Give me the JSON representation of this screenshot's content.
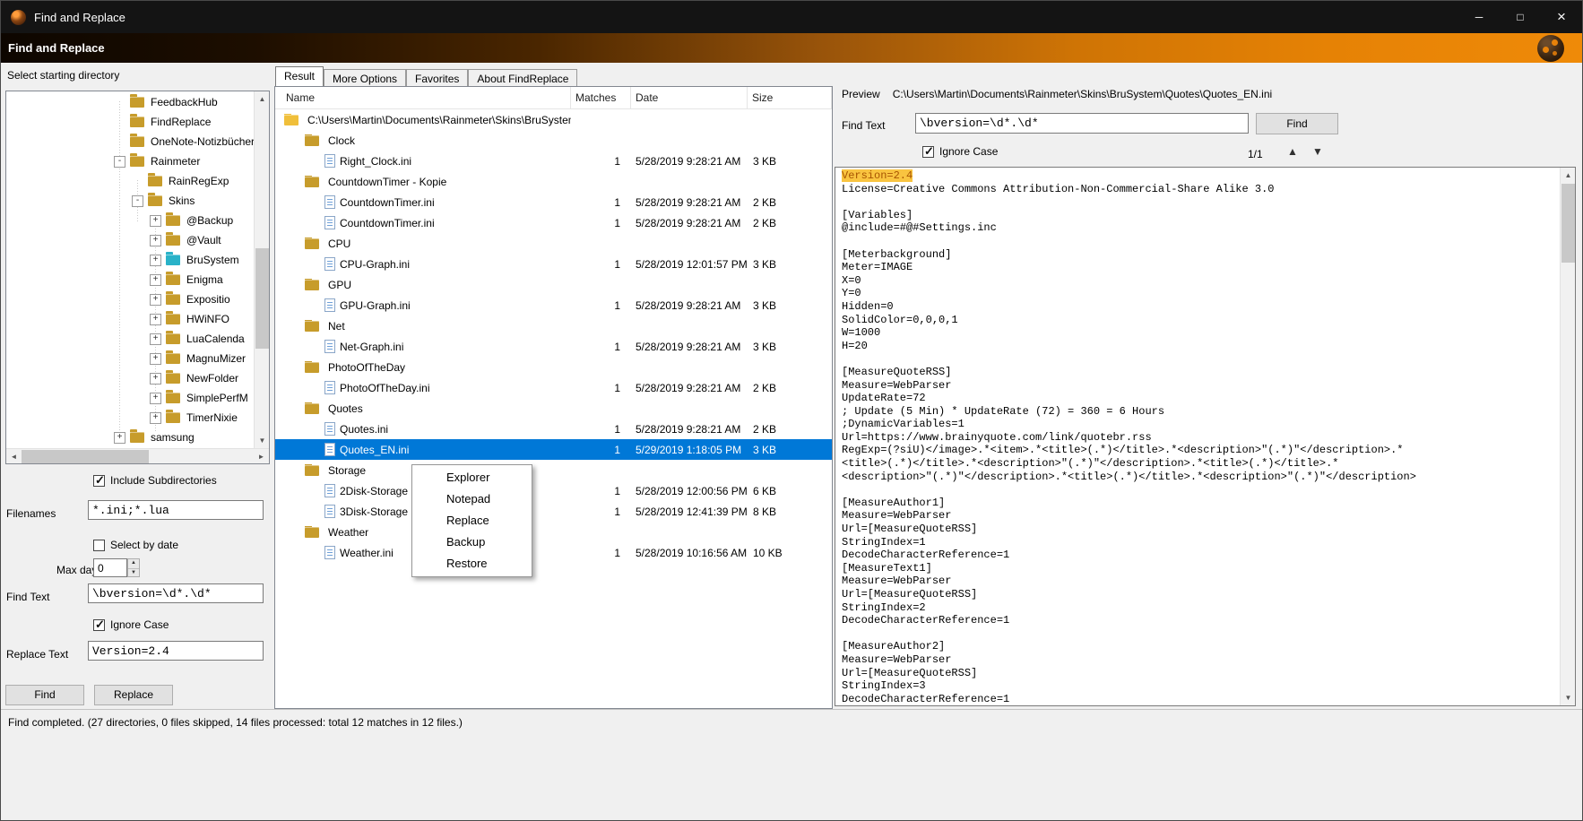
{
  "colors": {
    "accent_selection": "#0078D7",
    "banner_orange": "#EA8406",
    "match_highlight_bg": "#F9C440",
    "match_highlight_text": "#A85400",
    "folder_yellow": "#C79C2B",
    "folder_teal": "#29B2C8"
  },
  "titlebar": {
    "title": "Find and Replace",
    "minimize_glyph": "─",
    "maximize_glyph": "□",
    "close_glyph": "×"
  },
  "banner": {
    "title": "Find and Replace"
  },
  "left_panel": {
    "heading": "Select starting directory",
    "tree": [
      {
        "label": "FeedbackHub",
        "depth": 1,
        "expander": "",
        "selected": false
      },
      {
        "label": "FindReplace",
        "depth": 1,
        "expander": "",
        "selected": false
      },
      {
        "label": "OneNote-Notizbücher",
        "depth": 1,
        "expander": "",
        "selected": false
      },
      {
        "label": "Rainmeter",
        "depth": 1,
        "expander": "-",
        "selected": false
      },
      {
        "label": "RainRegExp",
        "depth": 2,
        "expander": "",
        "selected": false
      },
      {
        "label": "Skins",
        "depth": 2,
        "expander": "-",
        "selected": false
      },
      {
        "label": "@Backup",
        "depth": 3,
        "expander": "+",
        "selected": false
      },
      {
        "label": "@Vault",
        "depth": 3,
        "expander": "+",
        "selected": false
      },
      {
        "label": "BruSystem",
        "depth": 3,
        "expander": "+",
        "selected": true
      },
      {
        "label": "Enigma",
        "depth": 3,
        "expander": "+",
        "selected": false
      },
      {
        "label": "Expositio",
        "depth": 3,
        "expander": "+",
        "selected": false
      },
      {
        "label": "HWiNFO",
        "depth": 3,
        "expander": "+",
        "selected": false
      },
      {
        "label": "LuaCalenda",
        "depth": 3,
        "expander": "+",
        "selected": false
      },
      {
        "label": "MagnuMizer",
        "depth": 3,
        "expander": "+",
        "selected": false
      },
      {
        "label": "NewFolder",
        "depth": 3,
        "expander": "+",
        "selected": false
      },
      {
        "label": "SimplePerfM",
        "depth": 3,
        "expander": "+",
        "selected": false
      },
      {
        "label": "TimerNixie",
        "depth": 3,
        "expander": "+",
        "selected": false
      },
      {
        "label": "samsung",
        "depth": 1,
        "expander": "+",
        "selected": false
      }
    ],
    "include_subdirectories": {
      "label": "Include Subdirectories",
      "checked": true
    },
    "filenames": {
      "label": "Filenames",
      "value": "*.ini;*.lua"
    },
    "select_by_date": {
      "label": "Select by date",
      "checked": false
    },
    "max_days": {
      "label": "Max days",
      "value": "0"
    },
    "find_text": {
      "label": "Find Text",
      "value": "\\bversion=\\d*.\\d*"
    },
    "ignore_case": {
      "label": "Ignore Case",
      "checked": true
    },
    "replace_text": {
      "label": "Replace Text",
      "value": "Version=2.4"
    },
    "find_button": "Find",
    "replace_button": "Replace"
  },
  "tabs": {
    "items": [
      "Result",
      "More Options",
      "Favorites",
      "About FindReplace"
    ],
    "active_index": 0
  },
  "results": {
    "columns": [
      "Name",
      "Matches",
      "Date",
      "Size"
    ],
    "rows": [
      {
        "type": "root",
        "name": "C:\\Users\\Martin\\Documents\\Rainmeter\\Skins\\BruSystem",
        "matches": "",
        "date": "",
        "size": ""
      },
      {
        "type": "folder",
        "name": "Clock",
        "matches": "",
        "date": "",
        "size": ""
      },
      {
        "type": "file",
        "name": "Right_Clock.ini",
        "matches": "1",
        "date": "5/28/2019 9:28:21 AM",
        "size": "3 KB"
      },
      {
        "type": "folder",
        "name": "CountdownTimer - Kopie",
        "matches": "",
        "date": "",
        "size": ""
      },
      {
        "type": "file",
        "name": "CountdownTimer.ini",
        "matches": "1",
        "date": "5/28/2019 9:28:21 AM",
        "size": "2 KB"
      },
      {
        "type": "file",
        "name": "CountdownTimer.ini",
        "matches": "1",
        "date": "5/28/2019 9:28:21 AM",
        "size": "2 KB"
      },
      {
        "type": "folder",
        "name": "CPU",
        "matches": "",
        "date": "",
        "size": ""
      },
      {
        "type": "file",
        "name": "CPU-Graph.ini",
        "matches": "1",
        "date": "5/28/2019 12:01:57 PM",
        "size": "3 KB"
      },
      {
        "type": "folder",
        "name": "GPU",
        "matches": "",
        "date": "",
        "size": ""
      },
      {
        "type": "file",
        "name": "GPU-Graph.ini",
        "matches": "1",
        "date": "5/28/2019 9:28:21 AM",
        "size": "3 KB"
      },
      {
        "type": "folder",
        "name": "Net",
        "matches": "",
        "date": "",
        "size": ""
      },
      {
        "type": "file",
        "name": "Net-Graph.ini",
        "matches": "1",
        "date": "5/28/2019 9:28:21 AM",
        "size": "3 KB"
      },
      {
        "type": "folder",
        "name": "PhotoOfTheDay",
        "matches": "",
        "date": "",
        "size": ""
      },
      {
        "type": "file",
        "name": "PhotoOfTheDay.ini",
        "matches": "1",
        "date": "5/28/2019 9:28:21 AM",
        "size": "2 KB"
      },
      {
        "type": "folder",
        "name": "Quotes",
        "matches": "",
        "date": "",
        "size": ""
      },
      {
        "type": "file",
        "name": "Quotes.ini",
        "matches": "1",
        "date": "5/28/2019 9:28:21 AM",
        "size": "2 KB"
      },
      {
        "type": "file",
        "name": "Quotes_EN.ini",
        "matches": "1",
        "date": "5/29/2019 1:18:05 PM",
        "size": "3 KB",
        "selected": true
      },
      {
        "type": "folder",
        "name": "Storage",
        "matches": "",
        "date": "",
        "size": ""
      },
      {
        "type": "file",
        "name": "2Disk-Storage",
        "matches": "1",
        "date": "5/28/2019 12:00:56 PM",
        "size": "6 KB"
      },
      {
        "type": "file",
        "name": "3Disk-Storage",
        "matches": "1",
        "date": "5/28/2019 12:41:39 PM",
        "size": "8 KB"
      },
      {
        "type": "folder",
        "name": "Weather",
        "matches": "",
        "date": "",
        "size": ""
      },
      {
        "type": "file",
        "name": "Weather.ini",
        "matches": "1",
        "date": "5/28/2019 10:16:56 AM",
        "size": "10 KB"
      }
    ]
  },
  "context_menu": {
    "items": [
      "Explorer",
      "Notepad",
      "Replace",
      "Backup",
      "Restore"
    ]
  },
  "preview_panel": {
    "label": "Preview",
    "path": "C:\\Users\\Martin\\Documents\\Rainmeter\\Skins\\BruSystem\\Quotes\\Quotes_EN.ini",
    "find_label": "Find Text",
    "find_value": "\\bversion=\\d*.\\d*",
    "find_button": "Find",
    "ignore_case": {
      "label": "Ignore Case",
      "checked": true
    },
    "match_counter": "1/1",
    "prev_glyph": "▲",
    "next_glyph": "▼",
    "highlight_line_index": 0,
    "lines": [
      "Version=2.4",
      "License=Creative Commons Attribution-Non-Commercial-Share Alike 3.0",
      "",
      "[Variables]",
      "@include=#@#Settings.inc",
      "",
      "[Meterbackground]",
      "Meter=IMAGE",
      "X=0",
      "Y=0",
      "Hidden=0",
      "SolidColor=0,0,0,1",
      "W=1000",
      "H=20",
      "",
      "[MeasureQuoteRSS]",
      "Measure=WebParser",
      "UpdateRate=72",
      "; Update (5 Min) * UpdateRate (72) = 360 = 6 Hours",
      ";DynamicVariables=1",
      "Url=https://www.brainyquote.com/link/quotebr.rss",
      "RegExp=(?siU)</image>.*<item>.*<title>(.*)</title>.*<description>\"(.*)\"</description>.*",
      "<title>(.*)</title>.*<description>\"(.*)\"</description>.*<title>(.*)</title>.*",
      "<description>\"(.*)\"</description>.*<title>(.*)</title>.*<description>\"(.*)\"</description>",
      "",
      "[MeasureAuthor1]",
      "Measure=WebParser",
      "Url=[MeasureQuoteRSS]",
      "StringIndex=1",
      "DecodeCharacterReference=1",
      "[MeasureText1]",
      "Measure=WebParser",
      "Url=[MeasureQuoteRSS]",
      "StringIndex=2",
      "DecodeCharacterReference=1",
      "",
      "[MeasureAuthor2]",
      "Measure=WebParser",
      "Url=[MeasureQuoteRSS]",
      "StringIndex=3",
      "DecodeCharacterReference=1"
    ]
  },
  "status_bar": {
    "text": "Find completed. (27 directories, 0 files skipped, 14 files processed: total 12 matches in 12 files.)"
  }
}
